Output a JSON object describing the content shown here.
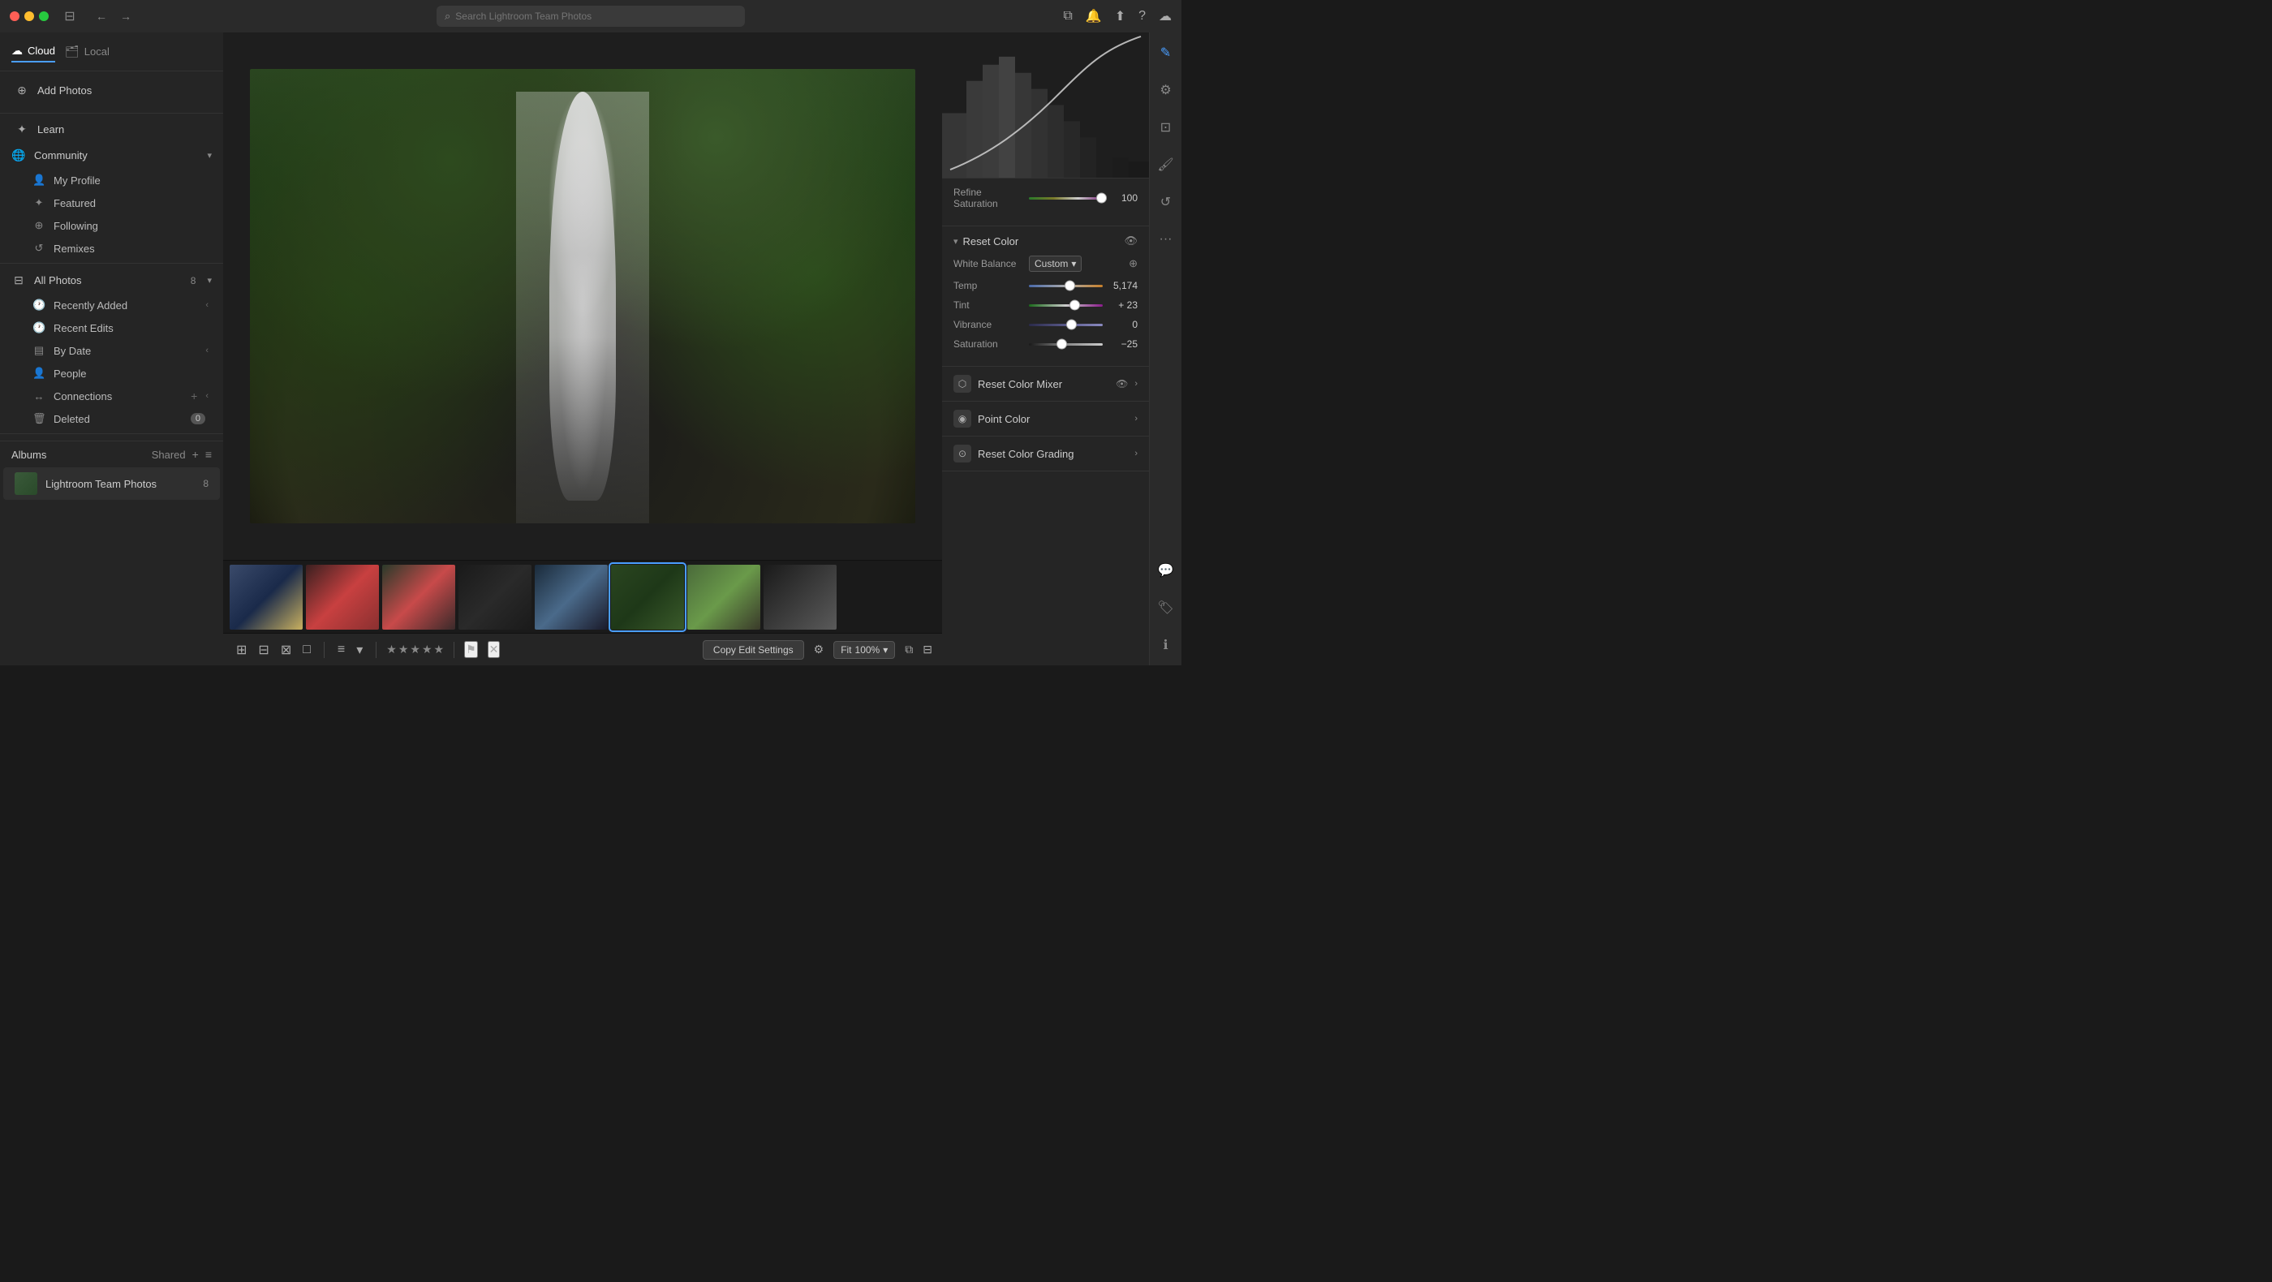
{
  "titlebar": {
    "search_placeholder": "Search Lightroom Team Photos",
    "back_label": "←",
    "forward_label": "→"
  },
  "tabs": {
    "cloud_label": "Cloud",
    "local_label": "Local"
  },
  "sidebar": {
    "add_photos_label": "Add Photos",
    "learn_label": "Learn",
    "community_label": "Community",
    "my_profile_label": "My Profile",
    "featured_label": "Featured",
    "following_label": "Following",
    "remixes_label": "Remixes",
    "all_photos_label": "All Photos",
    "all_photos_count": "8",
    "recently_added_label": "Recently Added",
    "recent_edits_label": "Recent Edits",
    "by_date_label": "By Date",
    "people_label": "People",
    "connections_label": "Connections",
    "deleted_label": "Deleted",
    "deleted_count": "0",
    "albums_label": "Albums",
    "shared_label": "Shared",
    "album_name": "Lightroom Team Photos",
    "album_count": "8"
  },
  "right_panel": {
    "histogram_label": "Histogram",
    "refine_saturation_label": "Refine Saturation",
    "refine_saturation_value": "100",
    "reset_color_label": "Reset Color",
    "white_balance_label": "White Balance",
    "white_balance_value": "Custom",
    "temp_label": "Temp",
    "temp_value": "5,174",
    "tint_label": "Tint",
    "tint_value": "+ 23",
    "vibrance_label": "Vibrance",
    "vibrance_value": "0",
    "saturation_label": "Saturation",
    "saturation_value": "−25",
    "reset_color_mixer_label": "Reset Color Mixer",
    "point_color_label": "Point Color",
    "reset_color_grading_label": "Reset Color Grading"
  },
  "bottom_toolbar": {
    "copy_edit_label": "Copy Edit Settings",
    "fit_label": "Fit",
    "zoom_label": "100%"
  }
}
